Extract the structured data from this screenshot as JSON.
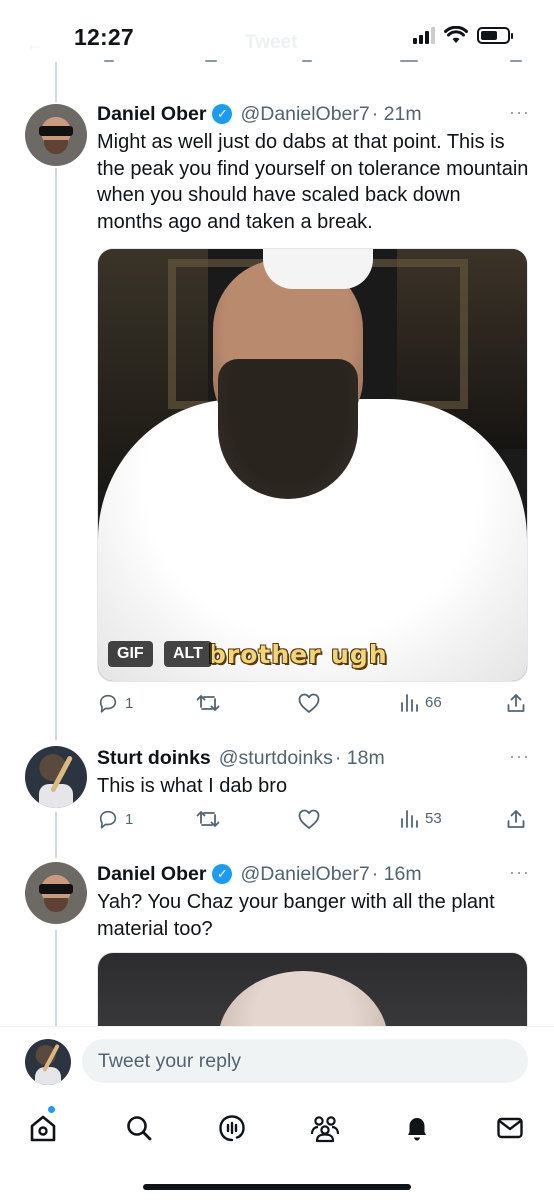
{
  "status_bar": {
    "time": "12:27",
    "ghost_title": "Tweet"
  },
  "tweets": [
    {
      "name": "Daniel Ober",
      "verified": true,
      "handle": "@DanielOber7",
      "time": "· 21m",
      "text": "Might as well just do dabs at that point. This is the peak you find yourself on tolerance mountain when you should have scaled back down months ago and taken a break.",
      "media": {
        "caption": "brother ugh",
        "gif_badge": "GIF",
        "alt_badge": "ALT"
      },
      "replies": "1",
      "views": "66"
    },
    {
      "name": "Sturt doinks",
      "verified": false,
      "handle": "@sturtdoinks",
      "time": "· 18m",
      "text": "This is what I dab bro",
      "replies": "1",
      "views": "53"
    },
    {
      "name": "Daniel Ober",
      "verified": true,
      "handle": "@DanielOber7",
      "time": "· 16m",
      "text": "Yah? You Chaz your banger with all the plant material too?"
    }
  ],
  "reply": {
    "placeholder": "Tweet your reply"
  },
  "colors": {
    "accent": "#1d9bf0",
    "secondary_text": "#536471",
    "thread_line": "#cfd9de"
  },
  "tab_bar": {
    "icons": [
      "home-icon",
      "search-icon",
      "spaces-icon",
      "communities-icon",
      "notifications-icon",
      "messages-icon"
    ]
  }
}
